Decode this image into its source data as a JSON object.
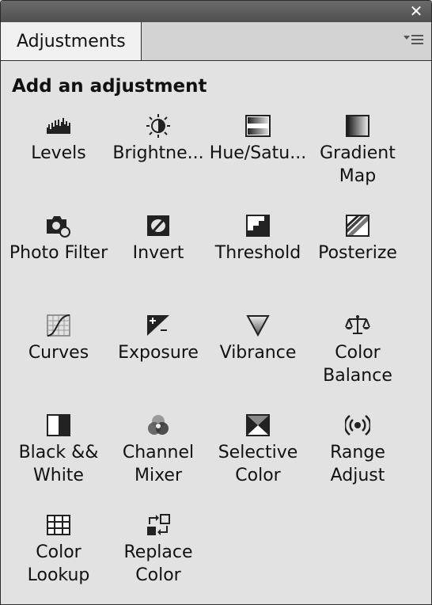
{
  "window": {
    "close_glyph": "✕"
  },
  "tab": {
    "label": "Adjustments"
  },
  "heading": "Add an adjustment",
  "items": [
    {
      "id": "levels",
      "label": "Levels",
      "icon": "levels-icon"
    },
    {
      "id": "brightness",
      "label": "Brightne...",
      "icon": "brightness-contrast-icon"
    },
    {
      "id": "hue",
      "label": "Hue/Satu...",
      "icon": "hue-saturation-icon"
    },
    {
      "id": "gradient-map",
      "label": "Gradient\nMap",
      "icon": "gradient-map-icon"
    },
    {
      "id": "photo-filter",
      "label": "Photo Filter",
      "icon": "photo-filter-icon"
    },
    {
      "id": "invert",
      "label": "Invert",
      "icon": "invert-icon"
    },
    {
      "id": "threshold",
      "label": "Threshold",
      "icon": "threshold-icon"
    },
    {
      "id": "posterize",
      "label": "Posterize",
      "icon": "posterize-icon"
    },
    {
      "id": "curves",
      "label": "Curves",
      "icon": "curves-icon"
    },
    {
      "id": "exposure",
      "label": "Exposure",
      "icon": "exposure-icon"
    },
    {
      "id": "vibrance",
      "label": "Vibrance",
      "icon": "vibrance-icon"
    },
    {
      "id": "color-balance",
      "label": "Color\nBalance",
      "icon": "color-balance-icon"
    },
    {
      "id": "black-white",
      "label": "Black &&\nWhite",
      "icon": "black-white-icon"
    },
    {
      "id": "channel-mixer",
      "label": "Channel\nMixer",
      "icon": "channel-mixer-icon"
    },
    {
      "id": "selective-color",
      "label": "Selective\nColor",
      "icon": "selective-color-icon"
    },
    {
      "id": "range-adjust",
      "label": "Range\nAdjust",
      "icon": "range-adjust-icon"
    },
    {
      "id": "color-lookup",
      "label": "Color\nLookup",
      "icon": "color-lookup-icon"
    },
    {
      "id": "replace-color",
      "label": "Replace\nColor",
      "icon": "replace-color-icon"
    }
  ]
}
